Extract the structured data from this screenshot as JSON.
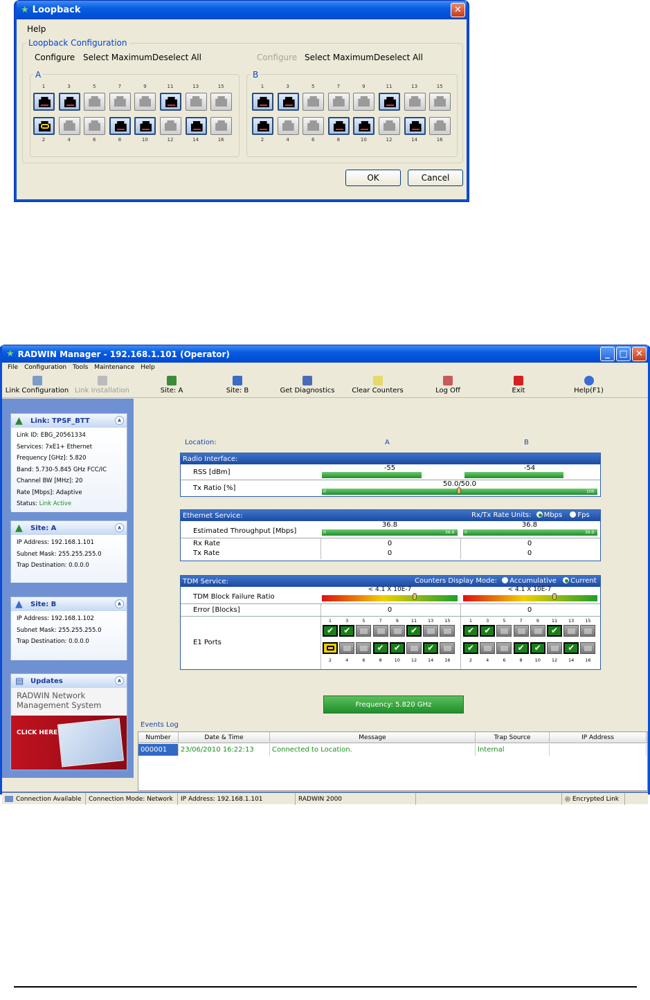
{
  "loopback": {
    "title": "Loopback",
    "menu_help": "Help",
    "group_title": "Loopback Configuration",
    "site_a": {
      "label": "A",
      "configure": "Configure",
      "select_max": "Select Maximum",
      "deselect": "Deselect All"
    },
    "site_b": {
      "label": "B",
      "configure": "Configure",
      "select_max": "Select Maximum",
      "deselect": "Deselect All"
    },
    "top_numbers": [
      "1",
      "3",
      "5",
      "7",
      "9",
      "11",
      "13",
      "15"
    ],
    "bottom_numbers": [
      "2",
      "4",
      "6",
      "8",
      "10",
      "12",
      "14",
      "16"
    ],
    "ok": "OK",
    "cancel": "Cancel"
  },
  "manager": {
    "title": "RADWIN Manager - 192.168.1.101 (Operator)",
    "menu": [
      "File",
      "Configuration",
      "Tools",
      "Maintenance",
      "Help"
    ],
    "toolbar": [
      "Link Configuration",
      "Link Installation",
      "Site: A",
      "Site: B",
      "Get Diagnostics",
      "Clear Counters",
      "Log Off",
      "Exit",
      "Help(F1)"
    ],
    "link_panel": {
      "title": "Link: TPSF_BTT",
      "lines": [
        "Link ID:  EBG_20561334",
        "Services:  7xE1+ Ethernet",
        "Frequency [GHz]:  5.820",
        "Band: 5.730-5.845 GHz FCC/IC",
        "Channel BW [MHz]:  20",
        "Rate [Mbps]:  Adaptive"
      ],
      "status_label": "Status:",
      "status_value": "Link Active"
    },
    "site_a_panel": {
      "title": "Site: A",
      "lines": [
        "IP Address:  192.168.1.101",
        "Subnet Mask:  255.255.255.0",
        "Trap Destination:  0.0.0.0"
      ]
    },
    "site_b_panel": {
      "title": "Site: B",
      "lines": [
        "IP Address:  192.168.1.102",
        "Subnet Mask:  255.255.255.0",
        "Trap Destination:  0.0.0.0"
      ]
    },
    "updates_panel": {
      "title": "Updates",
      "line1": "RADWIN Network",
      "line2": "Management System",
      "click": "CLICK HERE"
    },
    "location": {
      "label": "Location:",
      "a": "A",
      "b": "B"
    },
    "radio": {
      "title": "Radio Interface:",
      "rss_label": "RSS [dBm]",
      "rss_a": "-55",
      "rss_b": "-54",
      "tx_label": "Tx Ratio [%]",
      "tx_value": "50.0/50.0",
      "tx_min": "0",
      "tx_max": "100"
    },
    "ethernet": {
      "title": "Ethernet Service:",
      "units_label": "Rx/Tx Rate Units:",
      "unit_mbps": "Mbps",
      "unit_fps": "Fps",
      "thr_label": "Estimated Throughput [Mbps]",
      "thr_a": "36.8",
      "thr_b": "36.8",
      "scale_min": "0",
      "scale_max": "36.9",
      "rx_label": "Rx Rate",
      "tx_label": "Tx Rate",
      "rx_a": "0",
      "rx_b": "0",
      "tx_a": "0",
      "tx_b": "0"
    },
    "tdm": {
      "title": "TDM Service:",
      "mode_label": "Counters Display Mode:",
      "mode_acc": "Accumulative",
      "mode_cur": "Current",
      "bfr_label": "TDM Block Failure Ratio",
      "bfr_a": "< 4.1 X 10E-7",
      "bfr_b": "< 4.1 X 10E-7",
      "err_label": "Error [Blocks]",
      "err_a": "0",
      "err_b": "0",
      "e1_label": "E1 Ports"
    },
    "freq_button": "Frequency: 5.820 GHz",
    "events": {
      "title": "Events Log",
      "headers": [
        "Number",
        "Date & Time",
        "Message",
        "Trap Source",
        "IP Address"
      ],
      "row": [
        "000001",
        "23/06/2010 16:22:13",
        "Connected to Location.",
        "Internal",
        ""
      ]
    },
    "status": [
      "Connection Available",
      "Connection Mode: Network",
      "IP Address: 192.168.1.101",
      "RADWIN 2000",
      "Encrypted Link"
    ]
  }
}
